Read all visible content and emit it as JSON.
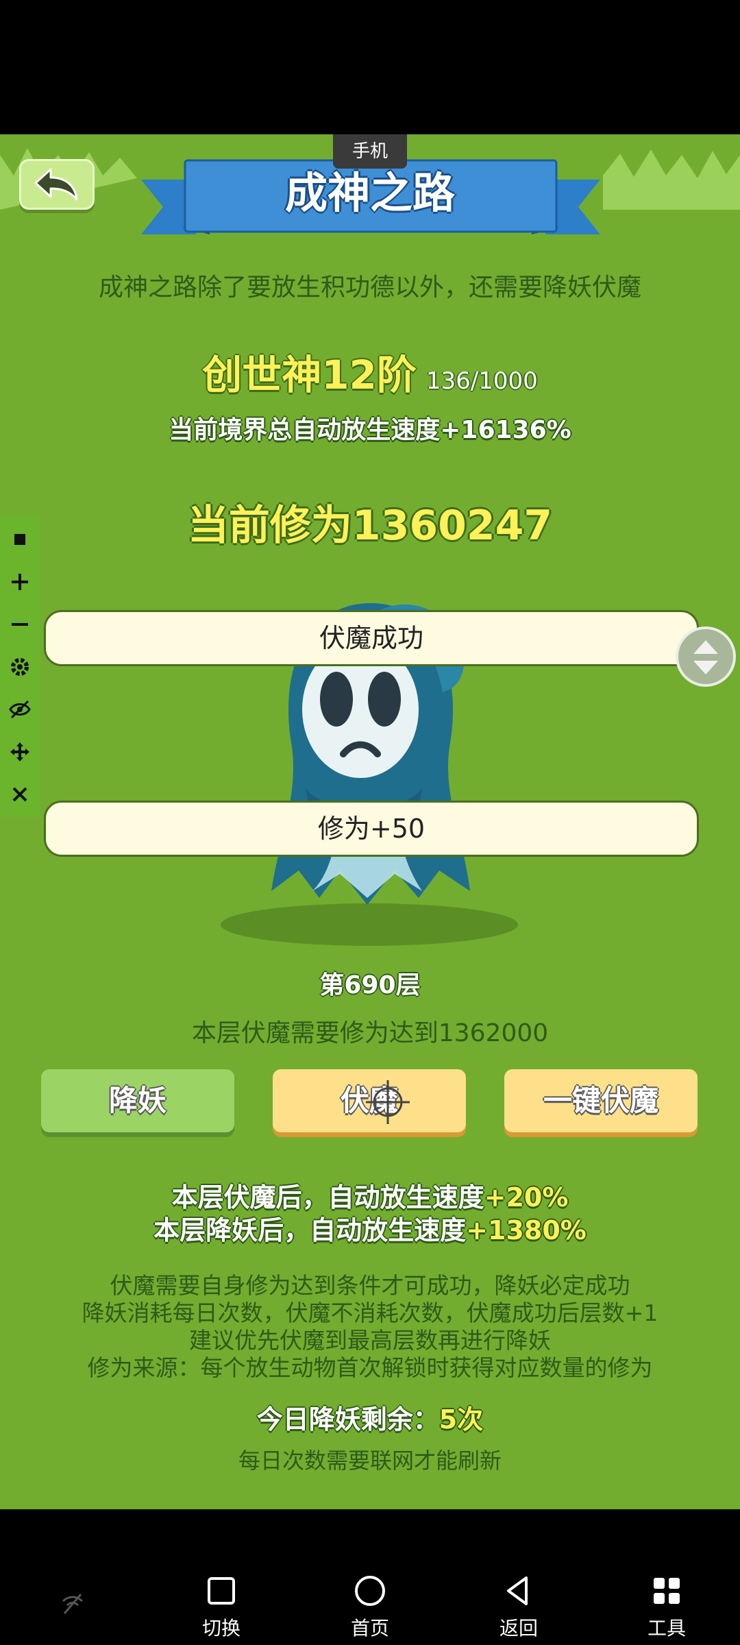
{
  "top_label": "手机",
  "title": "成神之路",
  "intro": "成神之路除了要放生积功德以外，还需要降妖伏魔",
  "rank": {
    "name": "创世神12阶",
    "progress": "136/1000"
  },
  "speed_total": "当前境界总自动放生速度+16136%",
  "cultivation": "当前修为1360247",
  "popups": [
    "伏魔成功",
    "修为+50"
  ],
  "floor": "第690层",
  "requirement": "本层伏魔需要修为达到1362000",
  "buttons": {
    "subdue_demon": "降妖",
    "exorcise": "伏魔",
    "one_key_exorcise": "一键伏魔"
  },
  "bonus": [
    {
      "prefix": "本层伏魔后，自动放生速度",
      "value": "+20%"
    },
    {
      "prefix": "本层降妖后，自动放生速度",
      "value": "+1380%"
    }
  ],
  "rules": [
    "伏魔需要自身修为达到条件才可成功，降妖必定成功",
    "降妖消耗每日次数，伏魔不消耗次数，伏魔成功后层数+1",
    "建议优先伏魔到最高层数再进行降妖",
    "修为来源：每个放生动物首次解锁时获得对应数量的修为"
  ],
  "remaining": {
    "label": "今日降妖剩余：",
    "value": "5次"
  },
  "refresh_note": "每日次数需要联网才能刷新",
  "toolbar_icons": [
    "stop-icon",
    "plus-icon",
    "minus-icon",
    "gear-icon",
    "eye-off-icon",
    "move-icon",
    "close-icon"
  ],
  "nav": [
    {
      "label": "切换",
      "icon": "square-icon"
    },
    {
      "label": "首页",
      "icon": "circle-icon"
    },
    {
      "label": "返回",
      "icon": "triangle-back-icon"
    },
    {
      "label": "工具",
      "icon": "grid-icon"
    }
  ],
  "colors": {
    "background": "#72ad2f",
    "highlight": "#fff158",
    "banner": "#3f8fd6"
  }
}
